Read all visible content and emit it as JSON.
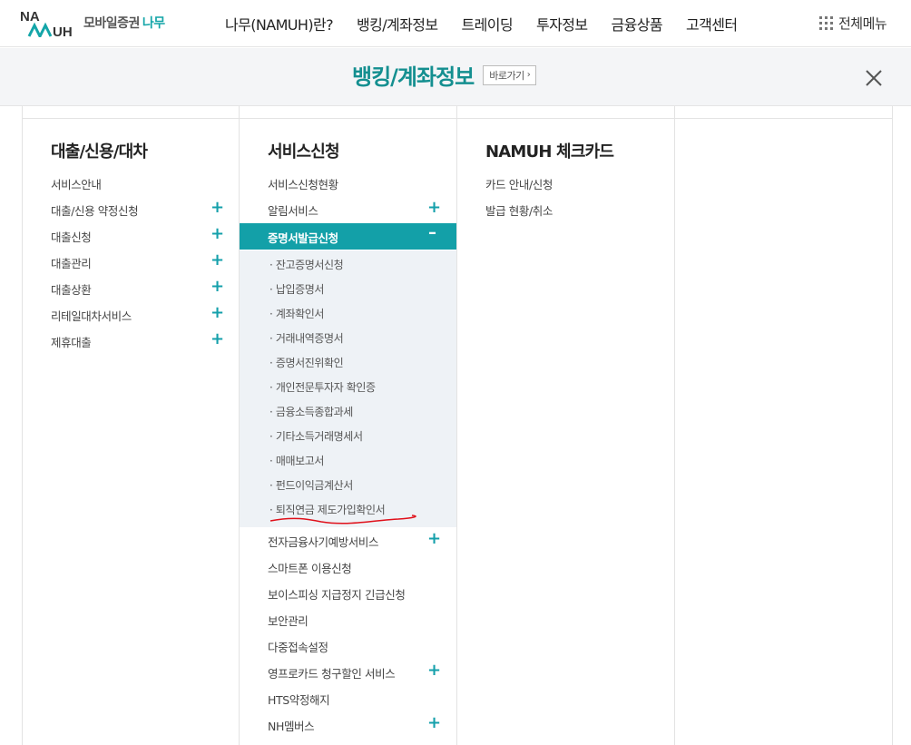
{
  "header": {
    "logo_mark": "NAMUH",
    "logo_text": "모바일증권",
    "logo_accent": "나무",
    "nav": [
      "나무(NAMUH)란?",
      "뱅킹/계좌정보",
      "트레이딩",
      "투자정보",
      "금융상품",
      "고객센터"
    ],
    "all_menu": "전체메뉴"
  },
  "titlebar": {
    "title": "뱅킹/계좌정보",
    "goto_label": "바로가기"
  },
  "columns": [
    {
      "title": "대출/신용/대차",
      "items": [
        {
          "label": "서비스안내",
          "expandable": false
        },
        {
          "label": "대출/신용 약정신청",
          "expandable": true
        },
        {
          "label": "대출신청",
          "expandable": true
        },
        {
          "label": "대출관리",
          "expandable": true
        },
        {
          "label": "대출상환",
          "expandable": true
        },
        {
          "label": "리테일대차서비스",
          "expandable": true
        },
        {
          "label": "제휴대출",
          "expandable": true
        }
      ]
    },
    {
      "title": "서비스신청",
      "items_top": [
        {
          "label": "서비스신청현황",
          "expandable": false
        },
        {
          "label": "알림서비스",
          "expandable": true
        }
      ],
      "active_item": {
        "label": "증명서발급신청",
        "icon": "minus-icon"
      },
      "sub_items": [
        "· 잔고증명서신청",
        "· 납입증명서",
        "· 계좌확인서",
        "· 거래내역증명서",
        "· 증명서진위확인",
        "· 개인전문투자자 확인증",
        "· 금융소득종합과세",
        "· 기타소득거래명세서",
        "· 매매보고서",
        "· 펀드이익금계산서",
        "· 퇴직연금 제도가입확인서"
      ],
      "items_bottom": [
        {
          "label": "전자금융사기예방서비스",
          "expandable": true
        },
        {
          "label": "스마트폰 이용신청",
          "expandable": false
        },
        {
          "label": "보이스피싱 지급정지 긴급신청",
          "expandable": false
        },
        {
          "label": "보안관리",
          "expandable": false
        },
        {
          "label": "다중접속설정",
          "expandable": false
        },
        {
          "label": "영프로카드 청구할인 서비스",
          "expandable": true
        },
        {
          "label": "HTS약정해지",
          "expandable": false
        },
        {
          "label": "NH멤버스",
          "expandable": true
        }
      ]
    },
    {
      "title": "NAMUH 체크카드",
      "items": [
        {
          "label": "카드 안내/신청",
          "expandable": false
        },
        {
          "label": "발급 현황/취소",
          "expandable": false
        }
      ]
    }
  ],
  "colors": {
    "accent": "#13a0a8",
    "title": "#148f90",
    "annotation": "#e0101a"
  }
}
